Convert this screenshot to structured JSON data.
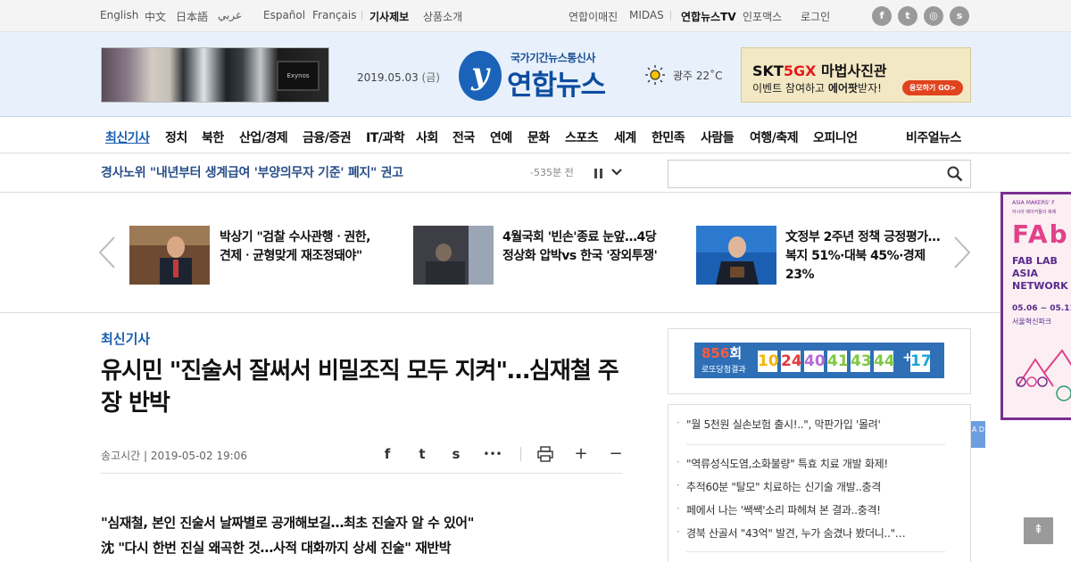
{
  "topbar": {
    "languages": [
      "English",
      "中文",
      "日本語",
      "عربي",
      "Español",
      "Français"
    ],
    "tip_label": "기사제보",
    "products_label": "상품소개",
    "util_links": [
      "연합이매진",
      "MIDAS",
      "연합뉴스TV",
      "인포맥스",
      "로그인"
    ],
    "sns": [
      "f",
      "t",
      "◎",
      "s"
    ]
  },
  "header": {
    "date": "2019.05.03",
    "weekday": "(금)",
    "logo_sub": "국가기간뉴스통신사",
    "logo_main": "연합뉴스",
    "logo_mark": "y",
    "weather": "광주 22˚C",
    "ad_left_chip": "Exynos",
    "ad_right": {
      "prefix": "SKT",
      "brand": "5GX",
      "title": "마법사진관",
      "line2_a": "이벤트 참여하고 ",
      "line2_b": "에어팟",
      "line2_c": "받자!",
      "button": "응모하기 GO>"
    }
  },
  "nav": {
    "items": [
      "최신기사",
      "정치",
      "북한",
      "산업/경제",
      "금융/증권",
      "IT/과학",
      "사회",
      "전국",
      "연예",
      "문화",
      "스포츠",
      "세계",
      "한민족",
      "사람들",
      "여행/축제",
      "오피니언"
    ],
    "visual_news": "비주얼뉴스"
  },
  "breaking": {
    "text": "경사노위 \"내년부터 생계급여 '부양의무자 기준' 폐지\" 권고",
    "time": "-535분 전"
  },
  "search": {
    "placeholder": ""
  },
  "carousel": {
    "items": [
      {
        "title": "박상기 \"검찰 수사관행ㆍ권한, 견제ㆍ균형맞게 재조정돼야\""
      },
      {
        "title": "4월국회 '빈손'종료 눈앞…4당 정상화 압박vs 한국 '장외투쟁'"
      },
      {
        "title": "文정부 2주년 정책 긍정평가…복지 51%·대북 45%·경제 23%"
      }
    ]
  },
  "article": {
    "category": "최신기사",
    "headline": "유시민 \"진술서 잘써서 비밀조직 모두 지켜\"…심재철 주장 반박",
    "send_time": "송고시간 | 2019-05-02 19:06",
    "summary": [
      "\"심재철, 본인 진술서 날짜별로 공개해보길…최초 진술자 알 수 있어\"",
      "沈 \"다시 한번 진실 왜곡한 것…사적 대화까지 상세 진술\" 재반박"
    ],
    "tools": [
      "f",
      "t",
      "s",
      "•••",
      "print",
      "+",
      "−"
    ]
  },
  "lotto": {
    "round": "856",
    "round_suffix": "회",
    "subtitle": "로또당첨결과",
    "numbers": [
      "10",
      "24",
      "40",
      "41",
      "43",
      "44"
    ],
    "plus": "+",
    "bonus": "17",
    "colors": [
      "#f2b600",
      "#e23b3b",
      "#b66bd8",
      "#7fc843",
      "#7fc843",
      "#7fc843",
      "#1ea6d6"
    ]
  },
  "ad_list": {
    "items": [
      "\"월 5천원 실손보험 출시!..\", 막판가입 '몰려'",
      "\"역류성식도염,소화불량\" 특효 치료 개발 화제!",
      "추적60분 \"탈모\" 치료하는 신기술 개발..충격",
      "페에서 나는 '쌕쌕'소리 파헤쳐 본 결과..충격!",
      "경북 산골서 \"43억\" 발견, 누가 숨겼나 봤더니..\"…"
    ],
    "badge": "A D"
  },
  "side_banner": {
    "line1": "ASIA MAKERS' F",
    "line2": "아시아 메이커들의 축제",
    "big": "FAb",
    "line3": "FAB LAB",
    "line4": "ASIA",
    "line5": "NETWORK",
    "dates": "05.06 ~ 05.11",
    "place": "서울혁신파크"
  },
  "top_button": "⇞"
}
